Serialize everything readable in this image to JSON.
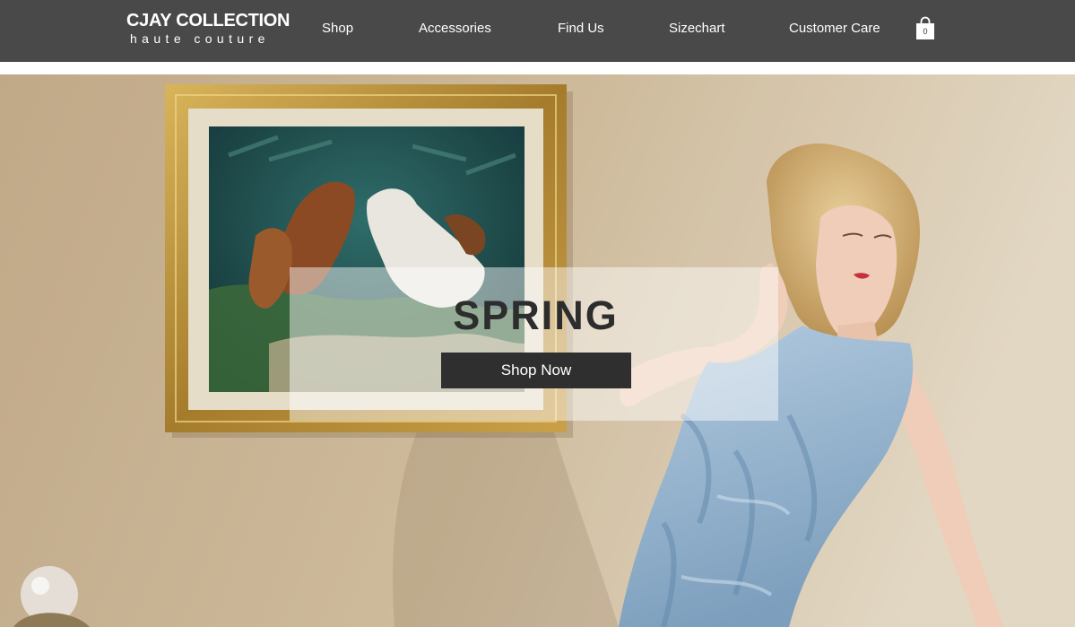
{
  "brand": {
    "name": "CJAY COLLECTION",
    "tagline": "haute couture"
  },
  "nav": {
    "items": [
      "Shop",
      "Accessories",
      "Find Us",
      "Sizechart",
      "Customer Care"
    ]
  },
  "cart": {
    "icon": "shopping-bag-icon",
    "count": "0"
  },
  "hero": {
    "headline": "SPRING",
    "cta_label": "Shop Now",
    "image": "woman-in-blue-beaded-gown-beside-framed-horse-painting"
  },
  "colors": {
    "header_bg": "#4a4949",
    "wall": "#cdb898",
    "button_bg": "#2f2f2f",
    "headline": "#2d2d2d"
  }
}
